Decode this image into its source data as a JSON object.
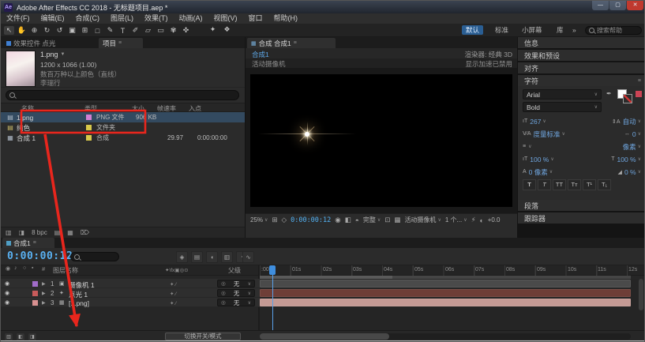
{
  "window": {
    "title": "Adobe After Effects CC 2018 - 无标题项目.aep *",
    "app_icon": "Ae",
    "controls": {
      "minimize": "—",
      "maximize": "▢",
      "close": "✕"
    }
  },
  "menu": {
    "items": [
      "文件(F)",
      "编辑(E)",
      "合成(C)",
      "图层(L)",
      "效果(T)",
      "动画(A)",
      "视图(V)",
      "窗口",
      "帮助(H)"
    ]
  },
  "toolbar": {
    "tools": [
      {
        "name": "selection-tool",
        "glyph": "↖"
      },
      {
        "name": "hand-tool",
        "glyph": "✋"
      },
      {
        "name": "zoom-tool",
        "glyph": "⊕"
      },
      {
        "name": "orbit-camera-tool",
        "glyph": "↻"
      },
      {
        "name": "rotation-tool",
        "glyph": "↺"
      },
      {
        "name": "camera-tool",
        "glyph": "▣"
      },
      {
        "name": "pan-behind-tool",
        "glyph": "⊞"
      },
      {
        "name": "shape-tool",
        "glyph": "□"
      },
      {
        "name": "pen-tool",
        "glyph": "✎"
      },
      {
        "name": "type-tool",
        "glyph": "T"
      },
      {
        "name": "brush-tool",
        "glyph": "✐"
      },
      {
        "name": "clone-stamp-tool",
        "glyph": "▱"
      },
      {
        "name": "eraser-tool",
        "glyph": "▭"
      },
      {
        "name": "roto-brush-tool",
        "glyph": "✾"
      },
      {
        "name": "puppet-tool",
        "glyph": "✜"
      }
    ],
    "extra_icons": [
      "✦",
      "❖"
    ],
    "workspaces": [
      "默认",
      "标准",
      "小屏幕",
      "库"
    ],
    "overflow": "»",
    "search_placeholder": "搜索帮助"
  },
  "project": {
    "tabs": [
      {
        "label": "效果控件 点光"
      },
      {
        "label": "项目"
      }
    ],
    "preview": {
      "name": "1.png",
      "dimensions": "1200 x 1066 (1.00)",
      "info_line1": "数百万种以上颜色（直线）",
      "info_line2": "李瑞行"
    },
    "columns": [
      "名称",
      "类型",
      "大小",
      "帧速率",
      "入点"
    ],
    "rows": [
      {
        "name": "1.png",
        "type": "PNG 文件",
        "size": "906 KB",
        "fps": "",
        "in_point": "",
        "label_color": "#d37fd3"
      },
      {
        "name": "纯色",
        "type": "文件夹",
        "size": "",
        "fps": "",
        "in_point": "",
        "label_color": "#d8c84a"
      },
      {
        "name": "合成 1",
        "type": "合成",
        "size": "",
        "fps": "29.97",
        "in_point": "0:00:00:00",
        "label_color": "#d8c84a"
      }
    ],
    "footer": {
      "depth": "8 bpc"
    }
  },
  "viewer": {
    "tab": "合成 合成1",
    "breadcrumb": "合成1",
    "renderer": "渲染器: 经典 3D",
    "view_label": "活动摄像机",
    "accel_note": "显示加速已禁用",
    "toolbar": {
      "zoom": "25%",
      "timecode": "0:00:00:12",
      "resolution": "完整",
      "view": "活动摄像机",
      "layout": "1 个...",
      "exposure": "+0.0"
    }
  },
  "right_panels": {
    "info": "信息",
    "effects_presets": "效果和预设",
    "align": "对齐",
    "character": "字符",
    "paragraph": "段落",
    "tracker": "跟踪器"
  },
  "character": {
    "font_family": "Arial",
    "font_style": "Bold",
    "font_size": "267",
    "leading": "自动",
    "kerning": "度量标准",
    "tracking": "0",
    "stroke_unit": "像素",
    "vertical_scale": "100 %",
    "horizontal_scale": "100 %",
    "baseline_shift": "0 像素",
    "tsume": "0 %",
    "faux": [
      "T",
      "T",
      "TT",
      "Tᴛ",
      "T¹",
      "T₁"
    ]
  },
  "timeline": {
    "tab": "合成1",
    "tab_chip_color": "#4f9ec4",
    "timecode": "0:00:00:12",
    "header": {
      "name_col": "图层名称",
      "parent_col": "父级"
    },
    "layers": [
      {
        "num": "1",
        "name": "摄像机 1",
        "parent": "无",
        "label_color": "#a06cc9",
        "bar_color": "#4a4a4a"
      },
      {
        "num": "2",
        "name": "点光 1",
        "parent": "无",
        "label_color": "#c75b5b",
        "bar_color": "#6e3e37"
      },
      {
        "num": "3",
        "name": "[1.png]",
        "parent": "无",
        "label_color": "#d89090",
        "bar_color": "#c49a94"
      }
    ],
    "ruler_labels": [
      ":00s",
      "01s",
      "02s",
      "03s",
      "04s",
      "05s",
      "06s",
      "07s",
      "08s",
      "09s",
      "10s",
      "11s",
      "12s"
    ],
    "footer": {
      "toggle_label": "切换开关/模式"
    }
  },
  "icons": {
    "panel_menu": "≡",
    "caret": "∨",
    "tab_caret": "▼",
    "eye": "◉",
    "audio": "♪",
    "solo": "○",
    "lock": "▪",
    "hash": "#",
    "pickwhip": "◎",
    "expander": "▶",
    "file": "▤",
    "folder": "▤",
    "comp": "▦",
    "camera_layer": "▣",
    "light_layer": "✦",
    "footage_layer": "▦",
    "grid": "⊞",
    "mask": "◇",
    "snapshot": "◉",
    "show_snapshot": "◧",
    "channels": "◓",
    "roi": "⊡",
    "transparency": "▦",
    "fast_preview": "⚡",
    "exposure": "◐",
    "mini_flowchart": "◈",
    "draft_3d": "▤",
    "shy": "◖",
    "frame_blend": "▥",
    "motion_blur": "◔",
    "graph_editor": "∿",
    "interpret": "▥",
    "second_footer": "◨",
    "new_folder": "▤",
    "new_comp": "▦",
    "trash": "⌦",
    "eyedropper": "✒",
    "font_size": "ıT",
    "leading": "⇕A",
    "kerning": "V∕A",
    "tracking": "↔",
    "stroke": "≡",
    "vscale": "ıT",
    "hscale": "T",
    "baseline": "A",
    "tsume": "◢",
    "switch_header": "✦\\fx▣◎⊙",
    "row_switches": "✦ ∕"
  },
  "ui": {
    "accent_blue": "#3f7fd2",
    "timecode_blue": "#59b1f2",
    "value_blue": "#6fa5de"
  },
  "annotation": {
    "color": "#e8261d"
  }
}
